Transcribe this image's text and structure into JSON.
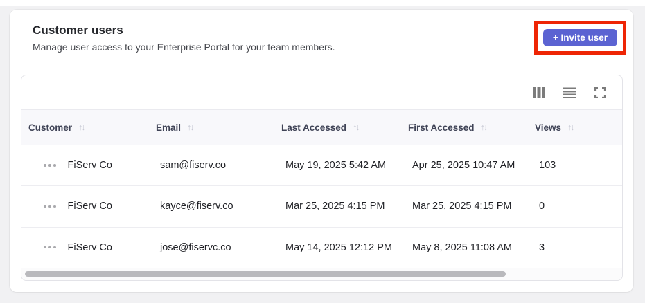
{
  "card": {
    "title": "Customer users",
    "subtitle": "Manage user access to your Enterprise Portal for your team members.",
    "invite_button": {
      "label": "+ Invite user",
      "color": "#5b63d2",
      "annotation_highlight_color": "#ee2505"
    }
  },
  "toolbar": {
    "icons": [
      {
        "name": "columns-icon"
      },
      {
        "name": "density-icon"
      },
      {
        "name": "fullscreen-icon"
      }
    ]
  },
  "table": {
    "sort_icon_glyph": "↑↓",
    "columns": [
      {
        "label": "Customer"
      },
      {
        "label": "Email"
      },
      {
        "label": "Last Accessed"
      },
      {
        "label": "First Accessed"
      },
      {
        "label": "Views"
      }
    ],
    "rows": [
      {
        "customer": "FiServ Co",
        "email": "sam@fiserv.co",
        "last_accessed": "May 19, 2025 5:42 AM",
        "first_accessed": "Apr 25, 2025 10:47 AM",
        "views": "103"
      },
      {
        "customer": "FiServ Co",
        "email": "kayce@fiserv.co",
        "last_accessed": "Mar 25, 2025 4:15 PM",
        "first_accessed": "Mar 25, 2025 4:15 PM",
        "views": "0"
      },
      {
        "customer": "FiServ Co",
        "email": "jose@fiservc.co",
        "last_accessed": "May 14, 2025 12:12 PM",
        "first_accessed": "May 8, 2025 11:08 AM",
        "views": "3"
      }
    ]
  }
}
